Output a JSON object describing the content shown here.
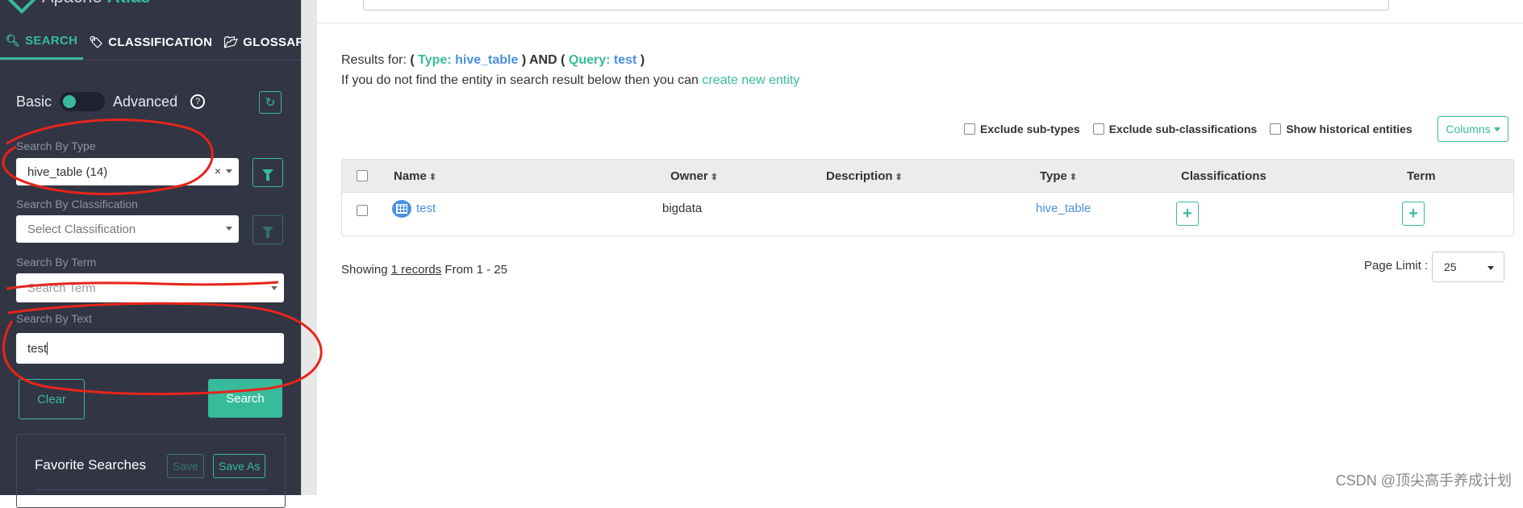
{
  "app": {
    "logo_prefix": "Apache",
    "logo_name": "Atlas"
  },
  "sidebar": {
    "tabs": [
      {
        "label": "SEARCH",
        "icon": "search-icon",
        "active": true
      },
      {
        "label": "CLASSIFICATION",
        "icon": "tag-icon",
        "active": false
      },
      {
        "label": "GLOSSARY",
        "icon": "folder-open-icon",
        "active": false
      }
    ],
    "mode": {
      "basic": "Basic",
      "advanced": "Advanced",
      "help_icon": "?"
    },
    "type": {
      "label": "Search By Type",
      "value": "hive_table",
      "count": "(14)",
      "clear": "×"
    },
    "classification": {
      "label": "Search By Classification",
      "placeholder": "Select Classification"
    },
    "term": {
      "label": "Search By Term",
      "placeholder": "Search Term"
    },
    "text": {
      "label": "Search By Text",
      "value": "test"
    },
    "buttons": {
      "clear": "Clear",
      "search": "Search"
    },
    "favorites": {
      "title": "Favorite Searches",
      "save": "Save",
      "save_as": "Save As"
    }
  },
  "main": {
    "results": {
      "prefix": "Results for:",
      "open1": "(",
      "type_key": "Type:",
      "type_val": "hive_table",
      "close_and": ") AND (",
      "query_key": "Query:",
      "query_val": "test",
      "close2": ")"
    },
    "hint": {
      "text": "If you do not find the entity in search result below then you can",
      "link": "create new entity"
    },
    "filters": {
      "exclude_subtypes": "Exclude sub-types",
      "exclude_subclass": "Exclude sub-classifications",
      "show_historical": "Show historical entities",
      "columns": "Columns"
    },
    "table": {
      "headers": {
        "name": "Name",
        "owner": "Owner",
        "description": "Description",
        "type": "Type",
        "classifications": "Classifications",
        "term": "Term"
      },
      "rows": [
        {
          "name": "test",
          "owner": "bigdata",
          "description": "",
          "type": "hive_table",
          "add_classification": "+",
          "add_term": "+"
        }
      ]
    },
    "pagination": {
      "showing": "Showing",
      "records": "1 records",
      "range": "From 1 - 25",
      "limit_label": "Page Limit :",
      "limit_value": "25"
    }
  },
  "watermark": "CSDN @顶尖高手养成计划",
  "colors": {
    "accent": "#37bb9b",
    "sidebar_bg": "#323544",
    "link_blue": "#4a90e2",
    "annotation_red": "#e8241a"
  }
}
